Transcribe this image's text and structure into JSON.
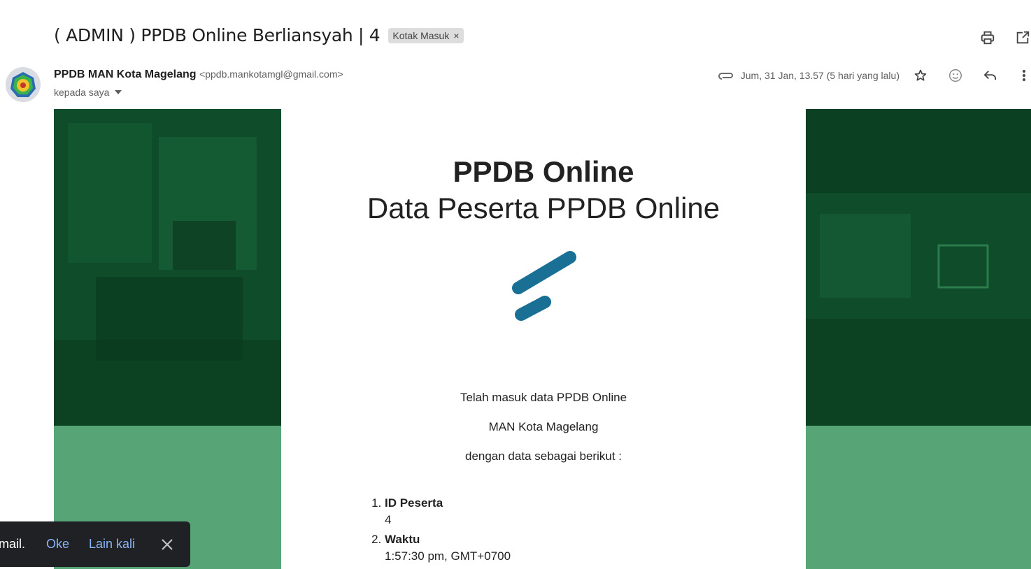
{
  "email": {
    "subject": "( ADMIN ) PPDB Online Berliansyah | 4",
    "label_chip": "Kotak Masuk",
    "label_remove": "×",
    "sender_name": "PPDB MAN Kota Magelang",
    "sender_email": "<ppdb.mankotamgl@gmail.com>",
    "recipient": "kepada saya",
    "date": "Jum, 31 Jan, 13.57 (5 hari yang lalu)"
  },
  "content": {
    "title": "PPDB Online",
    "subtitle": "Data Peserta PPDB Online",
    "intro_lines": [
      "Telah masuk data PPDB Online",
      "MAN Kota Magelang",
      "dengan data sebagai berikut :"
    ],
    "fields": [
      {
        "label": "ID Peserta",
        "value": "4"
      },
      {
        "label": "Waktu",
        "value": "1:57:30 pm, GMT+0700"
      }
    ],
    "logo_color": "#1a6f95"
  },
  "snackbar": {
    "message": "mail.",
    "ok_label": "Oke",
    "later_label": "Lain kali"
  },
  "colors": {
    "banner_dark": "#0f4d2a",
    "banner_light": "#57a576",
    "snackbar_bg": "#202124",
    "link_blue": "#8ab4f8"
  }
}
